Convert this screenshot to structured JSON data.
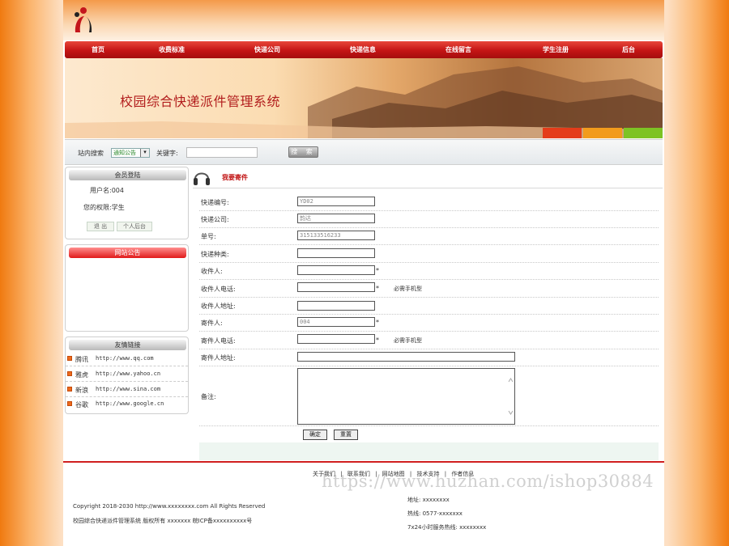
{
  "nav": [
    "首页",
    "收费标准",
    "快递公司",
    "快递信息",
    "在线留言",
    "学生注册",
    "后台"
  ],
  "banner": {
    "title": "校园综合快递派件管理系统"
  },
  "search": {
    "site_label": "站内搜索",
    "category_selected": "通知公告",
    "keyword_label": "关键字:",
    "button": "搜 索"
  },
  "login": {
    "header": "会员登陆",
    "username_line": "用户名:004",
    "role_line": "您的权限:学生",
    "logout": "退 出",
    "personal": "个人后台"
  },
  "notice": {
    "header": "网站公告"
  },
  "links": {
    "header": "友情链接",
    "items": [
      {
        "name": "腾讯",
        "url": "http://www.qq.com"
      },
      {
        "name": "雅虎",
        "url": "http://www.yahoo.cn"
      },
      {
        "name": "新浪",
        "url": "http://www.sina.com"
      },
      {
        "name": "谷歌",
        "url": "http://www.google.cn"
      }
    ]
  },
  "form": {
    "title": "我要寄件",
    "fields": {
      "express_no": {
        "label": "快递编号:",
        "value": "YD02"
      },
      "company": {
        "label": "快递公司:",
        "value": "韵达"
      },
      "order_no": {
        "label": "单号:",
        "value": "315133516233"
      },
      "express_type": {
        "label": "快递种类:",
        "value": ""
      },
      "receiver": {
        "label": "收件人:",
        "value": "",
        "required": "*"
      },
      "receiver_phone": {
        "label": "收件人电话:",
        "value": "",
        "required": "*",
        "hint": "必需手机型"
      },
      "receiver_addr": {
        "label": "收件人地址:",
        "value": ""
      },
      "sender": {
        "label": "寄件人:",
        "value": "004",
        "required": "*"
      },
      "sender_phone": {
        "label": "寄件人电话:",
        "value": "",
        "required": "*",
        "hint": "必需手机型"
      },
      "sender_addr": {
        "label": "寄件人地址:",
        "value": ""
      },
      "remark": {
        "label": "备注:",
        "value": ""
      }
    },
    "submit": "确定",
    "reset": "重置"
  },
  "footer": {
    "links": [
      "关于我们",
      "联系我们",
      "网站地图",
      "技术支持",
      "作者信息"
    ],
    "separator": "|",
    "copyright": "Copyright 2018-2030 http://www.xxxxxxxx.com All Rights Reserved",
    "rights": "校园综合快递派件管理系统 版权所有 xxxxxxx 皖ICP备xxxxxxxxxx号",
    "address": "地址: xxxxxxxx",
    "hotline": "热线: 0577-xxxxxxx",
    "service": "7x24小时服务热线: xxxxxxxx"
  },
  "watermark": "https://www.huzhan.com/ishop30884"
}
